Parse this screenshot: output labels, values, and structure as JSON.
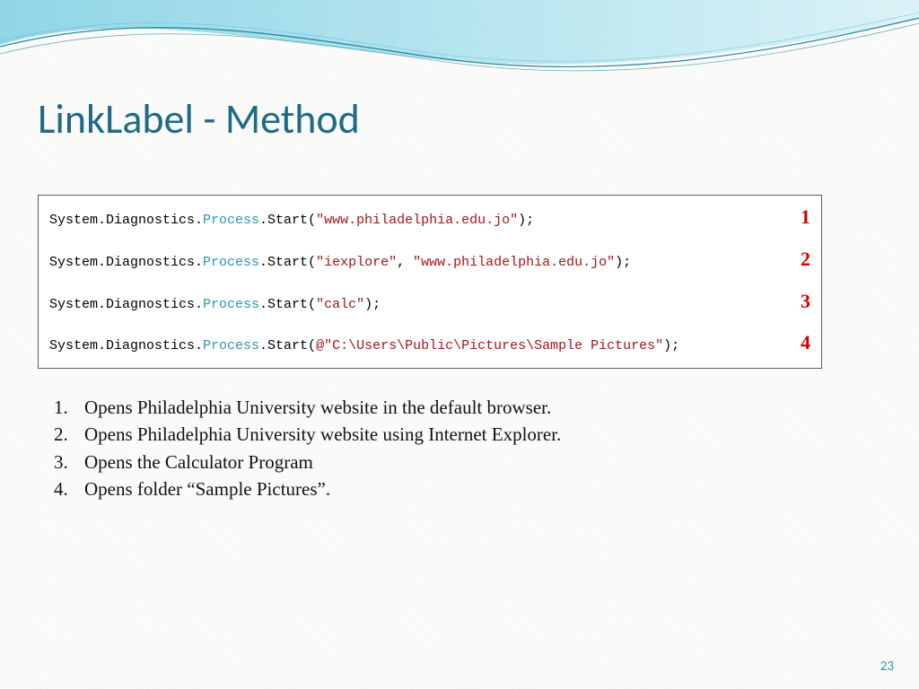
{
  "title": "LinkLabel - Method",
  "page_number": "23",
  "code": {
    "lines": [
      {
        "num": "1",
        "tokens": [
          {
            "cls": "tok-plain",
            "t": "System.Diagnostics."
          },
          {
            "cls": "tok-type",
            "t": "Process"
          },
          {
            "cls": "tok-plain",
            "t": ".Start("
          },
          {
            "cls": "tok-string",
            "t": "\"www.philadelphia.edu.jo\""
          },
          {
            "cls": "tok-plain",
            "t": ");"
          }
        ]
      },
      {
        "num": "2",
        "tokens": [
          {
            "cls": "tok-plain",
            "t": "System.Diagnostics."
          },
          {
            "cls": "tok-type",
            "t": "Process"
          },
          {
            "cls": "tok-plain",
            "t": ".Start("
          },
          {
            "cls": "tok-string",
            "t": "\"iexplore\""
          },
          {
            "cls": "tok-plain",
            "t": ", "
          },
          {
            "cls": "tok-string",
            "t": "\"www.philadelphia.edu.jo\""
          },
          {
            "cls": "tok-plain",
            "t": ");"
          }
        ]
      },
      {
        "num": "3",
        "tokens": [
          {
            "cls": "tok-plain",
            "t": "System.Diagnostics."
          },
          {
            "cls": "tok-type",
            "t": "Process"
          },
          {
            "cls": "tok-plain",
            "t": ".Start("
          },
          {
            "cls": "tok-string",
            "t": "\"calc\""
          },
          {
            "cls": "tok-plain",
            "t": ");"
          }
        ]
      },
      {
        "num": "4",
        "tokens": [
          {
            "cls": "tok-plain",
            "t": "System.Diagnostics."
          },
          {
            "cls": "tok-type",
            "t": "Process"
          },
          {
            "cls": "tok-plain",
            "t": ".Start("
          },
          {
            "cls": "tok-string",
            "t": "@\"C:\\Users\\Public\\Pictures\\Sample Pictures\""
          },
          {
            "cls": "tok-plain",
            "t": ");"
          }
        ]
      }
    ]
  },
  "list": [
    {
      "num": "1.",
      "text": "Opens Philadelphia University website in the default browser."
    },
    {
      "num": "2.",
      "text": "Opens Philadelphia University website using Internet Explorer."
    },
    {
      "num": "3.",
      "text": "Opens the Calculator Program"
    },
    {
      "num": "4.",
      "text": "Opens folder “Sample Pictures”."
    }
  ],
  "colors": {
    "accent": "#1d6b84",
    "code_type": "#2f93b3",
    "code_string": "#a31515",
    "annotation_red": "#d40000",
    "wave_fill": "#8bd4e6",
    "wave_fill2": "#c9ecf3",
    "wave_stroke": "#0d7a92"
  }
}
